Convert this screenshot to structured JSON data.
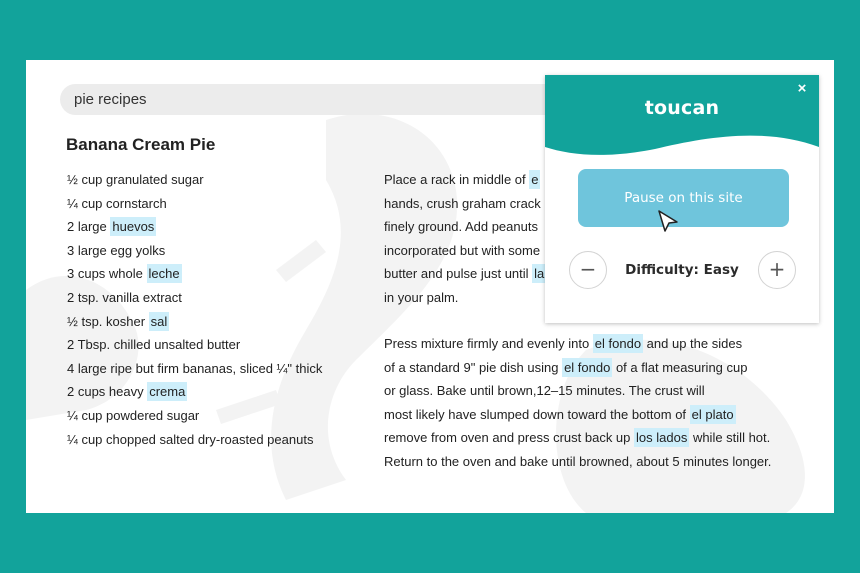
{
  "search": {
    "query": "pie recipes"
  },
  "recipe": {
    "title": "Banana Cream Pie",
    "ingredients": [
      {
        "pre": "½ cup granulated sugar",
        "hl": "",
        "post": ""
      },
      {
        "pre": "¼ cup cornstarch",
        "hl": "",
        "post": ""
      },
      {
        "pre": "2 large ",
        "hl": "huevos",
        "post": ""
      },
      {
        "pre": "3 large egg yolks",
        "hl": "",
        "post": ""
      },
      {
        "pre": "3 cups whole ",
        "hl": "leche",
        "post": ""
      },
      {
        "pre": "2 tsp. vanilla extract",
        "hl": "",
        "post": ""
      },
      {
        "pre": "½ tsp. kosher ",
        "hl": "sal",
        "post": ""
      },
      {
        "pre": "2 Tbsp. chilled unsalted butter",
        "hl": "",
        "post": ""
      },
      {
        "pre": "4 large ripe but firm bananas, sliced ¼\" thick",
        "hl": "",
        "post": ""
      },
      {
        "pre": "2 cups heavy ",
        "hl": "crema",
        "post": ""
      },
      {
        "pre": "¼ cup powdered sugar",
        "hl": "",
        "post": ""
      },
      {
        "pre": "¼ cup chopped salted dry-roasted peanuts",
        "hl": "",
        "post": ""
      }
    ],
    "directions_1": [
      {
        "pre": "Place a rack in middle of ",
        "hl": "e",
        "post": ""
      },
      {
        "pre": "hands, crush graham crack",
        "hl": "",
        "post": ""
      },
      {
        "pre": "finely ground. Add peanuts",
        "hl": "",
        "post": ""
      },
      {
        "pre": "incorporated but with some",
        "hl": "",
        "post": ""
      },
      {
        "pre": "butter and pulse just until ",
        "hl": "la",
        "post": ""
      },
      {
        "pre": "in your palm.",
        "hl": "",
        "post": ""
      }
    ],
    "directions_2": [
      {
        "pre": "Press mixture firmly and evenly into ",
        "hl": "el fondo",
        "post": " and up the sides"
      },
      {
        "pre": "of a standard 9\" pie dish using ",
        "hl": "el fondo",
        "post": " of a flat measuring cup"
      },
      {
        "pre": "or glass. Bake until brown,12–15 minutes. The crust will",
        "hl": "",
        "post": ""
      },
      {
        "pre": "most likely have slumped down toward the bottom of ",
        "hl": "el plato",
        "post": ""
      },
      {
        "pre": "remove from oven and press crust back up ",
        "hl": "los lados",
        "post": " while still hot."
      },
      {
        "pre": "Return to the oven and bake until browned, about 5 minutes longer.",
        "hl": "",
        "post": ""
      }
    ]
  },
  "popup": {
    "logo": "toucan",
    "close": "×",
    "pause_label": "Pause on this site",
    "minus": "−",
    "difficulty": "Difficulty: Easy",
    "plus": "+"
  },
  "colors": {
    "background": "#12a39b",
    "brand": "#12a39b",
    "highlight": "#cdeefa",
    "pause_button": "#6fc5dc"
  }
}
